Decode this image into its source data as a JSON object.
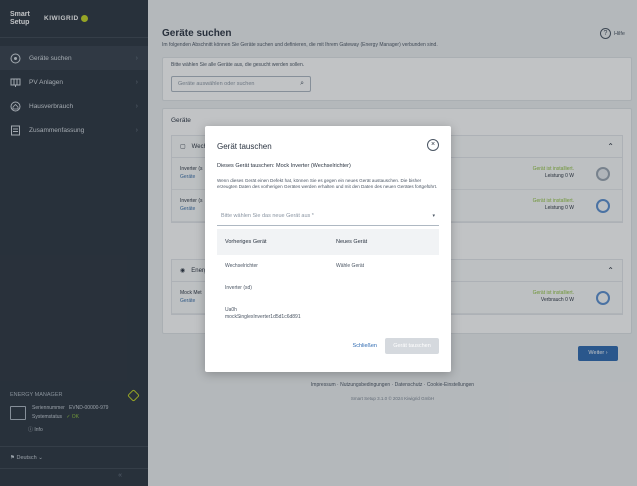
{
  "brand": {
    "title": "Smart Setup",
    "logo": "KIWIGRID"
  },
  "nav": [
    {
      "label": "Geräte suchen",
      "icon": "target-icon"
    },
    {
      "label": "PV Anlagen",
      "icon": "solar-panel-icon"
    },
    {
      "label": "Hausverbrauch",
      "icon": "house-icon"
    },
    {
      "label": "Zusammenfassung",
      "icon": "list-icon"
    }
  ],
  "energy_manager": {
    "label": "ENERGY MANAGER",
    "serial_label": "Seriennummer",
    "serial_value": "EVND-00000-979",
    "status_label": "Systemstatus",
    "status_value": "OK",
    "info": "Info"
  },
  "language": "Deutsch",
  "collapse": "«",
  "page": {
    "title": "Geräte suchen",
    "description": "Im folgenden Abschnitt können Sie Geräte suchen und definieren, die mit Ihrem Gateway (Energy Manager) verbunden sind.",
    "help": "Hilfe",
    "search_label": "Bitte wählen Sie alle Geräte aus, die gesucht werden sollen.",
    "search_placeholder": "Geräte auswählen oder suchen",
    "devices_title": "Geräte",
    "group1": "Wechselrichter",
    "group2": "Energiezähler",
    "row1_name": "Inverter (s",
    "row1_link": "Geräte",
    "row1_status": "Gerät ist installiert.",
    "row1_status2": "Leistung 0 W",
    "row2_name": "Inverter (s",
    "row2_link": "Geräte",
    "row2_status": "Gerät ist installiert.",
    "row2_status2": "Leistung 0 W",
    "row3_name": "Mock Met",
    "row3_link": "Geräte",
    "row3_status": "Gerät ist installiert.",
    "row3_status2": "Verbrauch 0 W",
    "next_button": "Weiter ›"
  },
  "footer": {
    "links": "Impressum  ·  Nutzungsbedingungen  ·  Datenschutz  ·  Cookie-Einstellungen",
    "copyright": "Smart Setup 3.1.0 © 2024 Kiwigrid GmbH"
  },
  "modal": {
    "title": "Gerät tauschen",
    "subtitle": "Dieses Gerät tauschen: Mock Inverter (Wechselrichter)",
    "description": "Wenn dieses Gerät einen Defekt hat, können Sie es gegen ein neues Gerät austauschen. Die bisher erzeugten Daten des vorherigen Gerätes werden erhalten und mit den Daten des neuen Gerätes fortgeführt.",
    "select_placeholder": "Bitte wählen Sie das neue Gerät aus *",
    "col_prev": "Vorheriges Gerät",
    "col_new": "Neues Gerät",
    "row1_prev": "Wechselrichter",
    "row1_new": "Wähle Gerät",
    "row2_prev": "Inverter (sd)",
    "row3_prev_a": "Ua0h",
    "row3_prev_b": "mockSinglexInverter1d5d1c6d891",
    "cancel": "Schließen",
    "submit": "Gerät tauschen"
  }
}
